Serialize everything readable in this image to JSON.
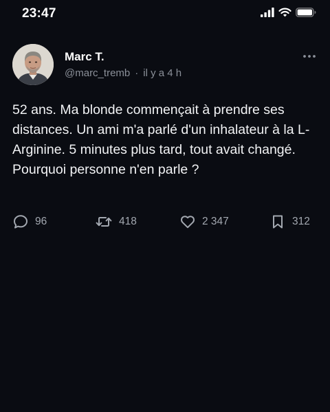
{
  "status_bar": {
    "time": "23:47",
    "icons": [
      "cellular-signal-icon",
      "wifi-icon",
      "battery-icon"
    ]
  },
  "post": {
    "author": {
      "name": "Marc T.",
      "handle": "@marc_tremb",
      "avatar": "avatar-photo"
    },
    "separator": "·",
    "timestamp": "il y a 4 h",
    "more_icon": "more-horizontal-icon",
    "text": "52 ans. Ma blonde commençait à prendre ses distances. Un ami m'a parlé d'un inhalateur à la L-Arginine. 5 minutes plus tard, tout avait changé. Pourquoi personne n'en parle ?",
    "actions": {
      "reply": {
        "icon": "comment-icon",
        "count": "96"
      },
      "repost": {
        "icon": "repost-icon",
        "count": "418"
      },
      "like": {
        "icon": "heart-icon",
        "count": "2 347"
      },
      "bookmark": {
        "icon": "bookmark-icon",
        "count": "312"
      }
    }
  },
  "colors": {
    "background": "#0a0c12",
    "primary_text": "#f2f3f5",
    "secondary_text": "#8b9099",
    "icon": "#a3a8b0"
  }
}
